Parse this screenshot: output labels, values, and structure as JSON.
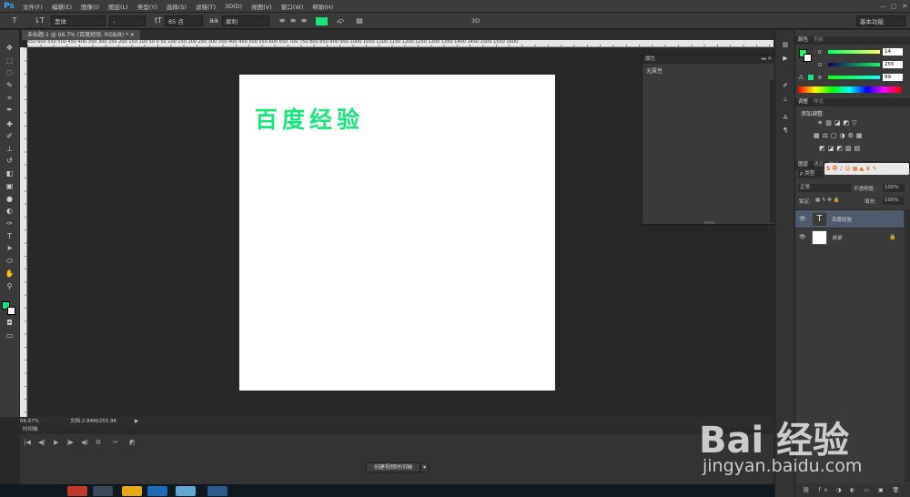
{
  "app": {
    "logo": "Ps"
  },
  "menu": [
    "文件(F)",
    "编辑(E)",
    "图像(I)",
    "图层(L)",
    "类型(Y)",
    "选择(S)",
    "滤镜(T)",
    "3D(D)",
    "视图(V)",
    "窗口(W)",
    "帮助(H)"
  ],
  "window_controls": [
    "—",
    "□",
    "✕"
  ],
  "options": {
    "tool_icon": "T",
    "orient_icon": "⇂T",
    "font_family": "黑体",
    "font_style": "-",
    "size_icon": "tT",
    "font_size": "85 点",
    "aa_icon": "aa",
    "aa_mode": "犀利",
    "mode_3d": "3D",
    "workspace": "基本功能",
    "text_color": "#19e57f"
  },
  "doc_tab": "未标题-1 @ 66.7% (百度经验, RGB/8) * ✕",
  "ruler_ticks": "650 600 550 500 450 400 350 300 250 200 150 100 50 0 50 100 150 200 250 300 350 400 450 500 550 600 650 700 750 800 850 900 950 1000 1050 1100 1150 1200 1250 1300 1350 1400 1450 1500 1550 1600",
  "canvas_text": "百度经验",
  "properties": {
    "title": "属性",
    "body": "无属性",
    "ctrl": "◂◂ ✕"
  },
  "status": {
    "zoom": "66.67%",
    "doc": "文档:2.84M/255.9K",
    "arrow": "▶"
  },
  "timeline": {
    "title": "时间轴",
    "create_button": "创建视频时间轴",
    "arrow": "▾",
    "controls": [
      "|◀",
      "◀|",
      "▶",
      "|▶",
      "◀)",
      "⚙",
      "✂",
      "◩"
    ]
  },
  "color_panel": {
    "tabs": [
      "颜色",
      "色板"
    ],
    "rows": [
      {
        "label": "R",
        "value": "14"
      },
      {
        "label": "G",
        "value": "255"
      },
      {
        "label": "B",
        "value": "99"
      }
    ]
  },
  "adjust_panel": {
    "tabs": [
      "调整",
      "样式"
    ],
    "add_label": "添加调整",
    "row1": "☀▥◪◩▽",
    "row2": "▦⚖▢◑⚙▦",
    "row3": "◩◪◩▨▤"
  },
  "layers_panel": {
    "tabs": [
      "图层",
      "通道",
      "路径"
    ],
    "filter": "ρ 类型",
    "blend": "正常",
    "opacity_label": "不透明度:",
    "opacity": "100%",
    "lock_label": "锁定:",
    "lock_icons": "▦ ✎ ✥ 🔒",
    "fill_label": "填充:",
    "fill": "100%",
    "ime": "S 中 ♪ ☺ ▦ ▲ ♛ ✎",
    "layers": [
      {
        "name": "百度经验",
        "thumb": "T"
      },
      {
        "name": "背景",
        "lock": "🔒"
      }
    ],
    "footer": "⛓ fx ◑ ◐ ▭ ▣ 🗑"
  },
  "watermark": {
    "brand": "Bai 经验",
    "url": "jingyan.baidu.com"
  }
}
